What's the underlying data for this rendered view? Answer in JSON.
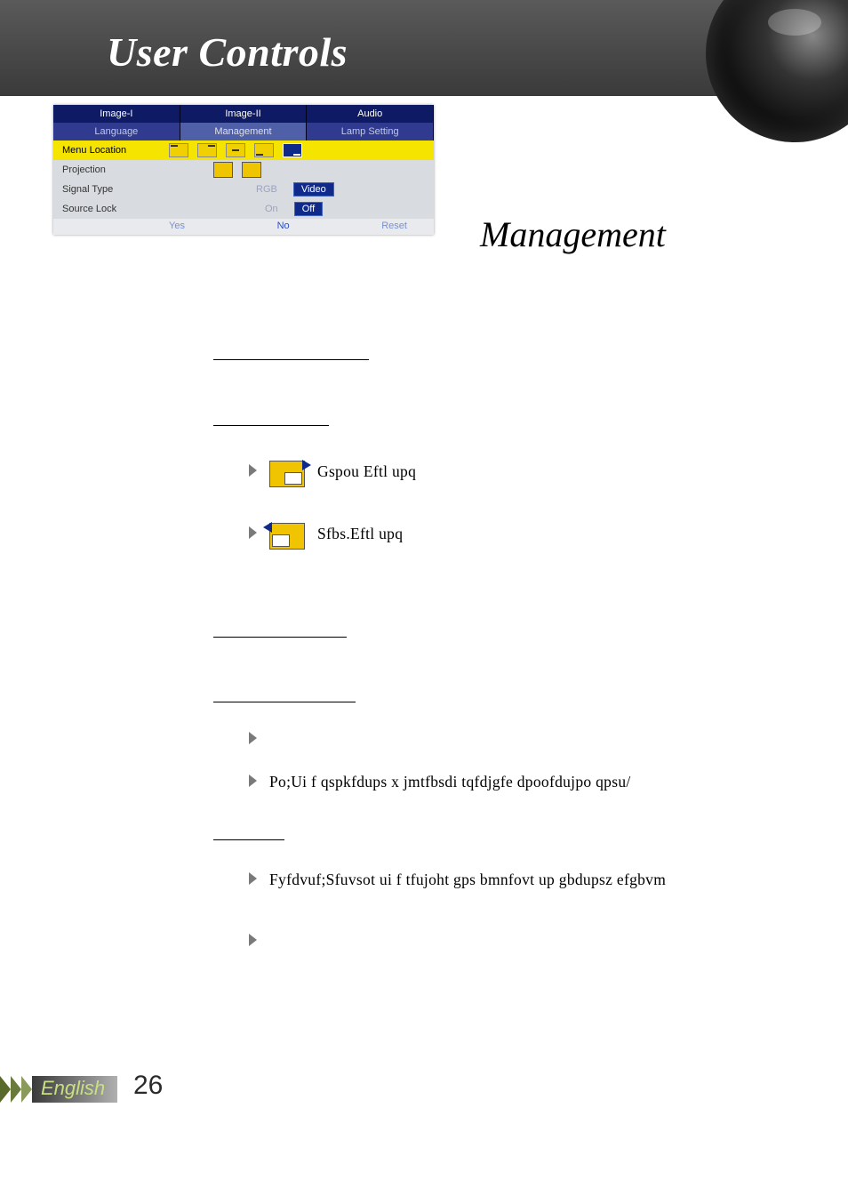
{
  "header": {
    "title": "User Controls"
  },
  "section": {
    "title": "Management"
  },
  "osd": {
    "tabs_top": [
      "Image-I",
      "Image-II",
      "Audio"
    ],
    "tabs_bot": [
      "Language",
      "Management",
      "Lamp Setting"
    ],
    "rows": {
      "menu_location": "Menu Location",
      "projection": "Projection",
      "signal_type": "Signal Type",
      "signal_rgb": "RGB",
      "signal_video": "Video",
      "source_lock": "Source Lock",
      "on": "On",
      "off": "Off"
    },
    "footer": {
      "yes": "Yes",
      "no": "No",
      "reset": "Reset"
    }
  },
  "body": {
    "front_desktop": "Gspou Eftl upq",
    "rear_desktop": "Sfbs.Eftl upq",
    "on_line": "Po;Ui f qspkfdups x jmtfbsdi tqfdjgfe dpoofdujpo qpsu/",
    "execute_line": "Fyfdvuf;Sfuvsot ui f tfujoht gps bmnfovt up gbdupsz efgbvm"
  },
  "footer": {
    "language": "English",
    "page": "26"
  }
}
